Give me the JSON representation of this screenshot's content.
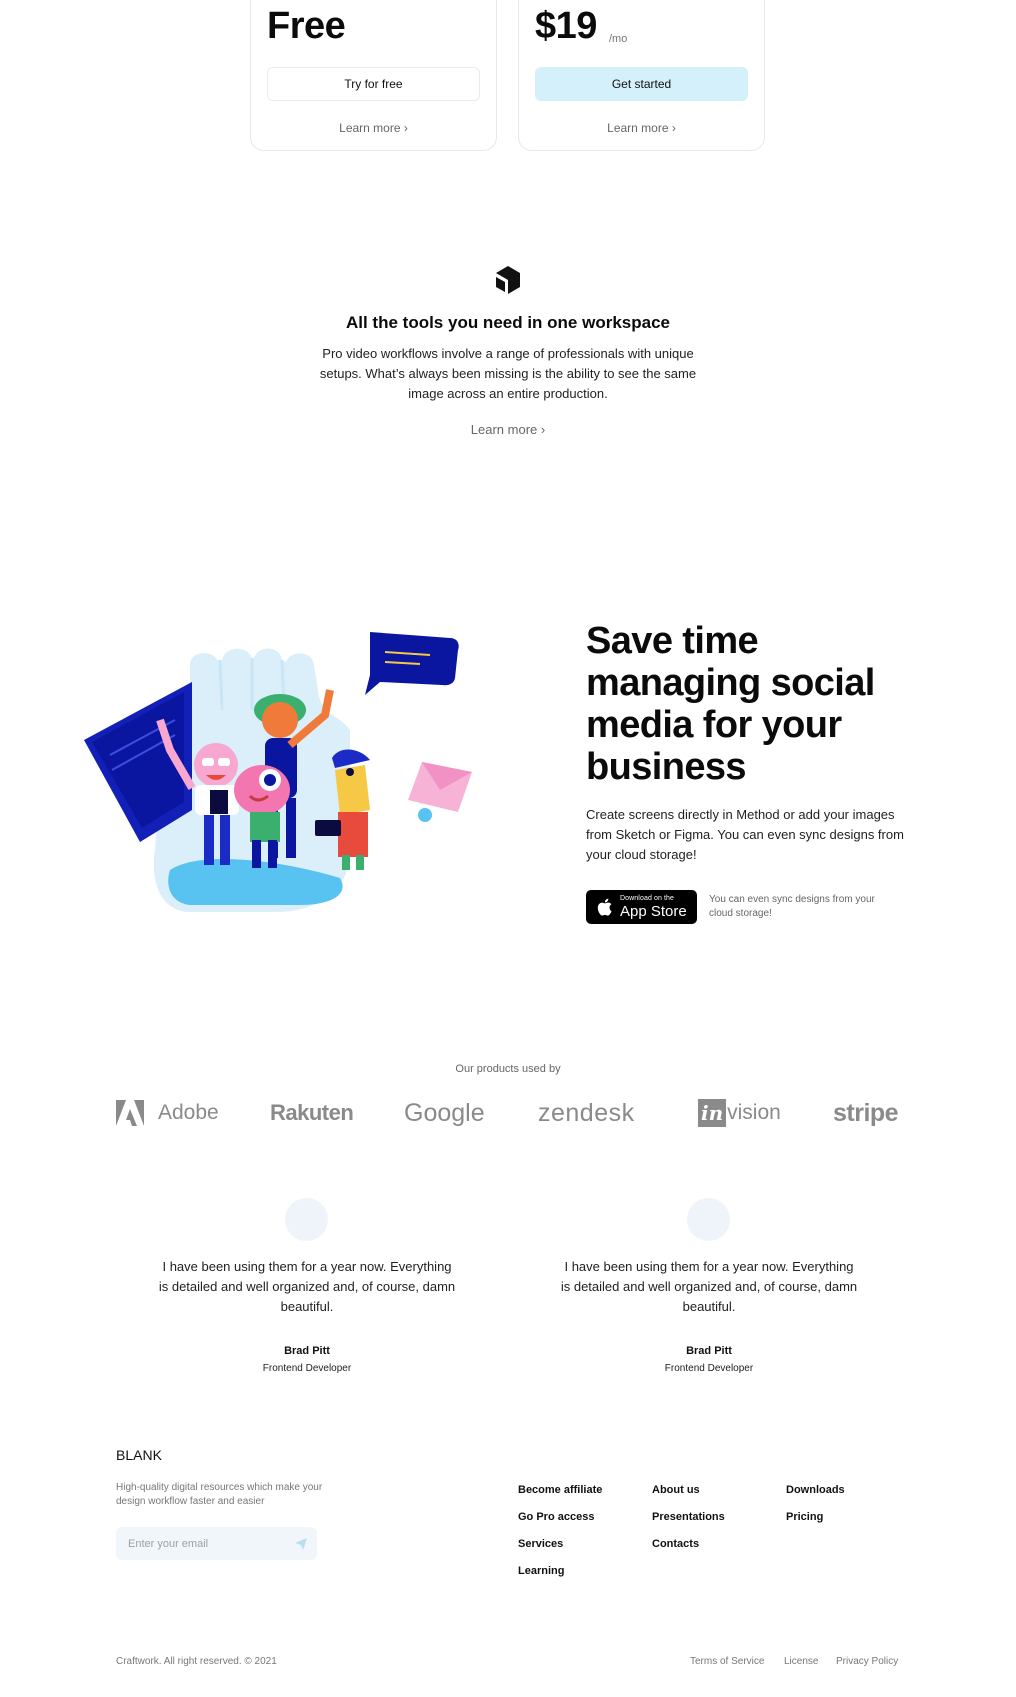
{
  "pricing": {
    "free": {
      "price": "Free",
      "button": "Try for free",
      "learn": "Learn more ›"
    },
    "pro": {
      "price": "$19",
      "period": "/mo",
      "button": "Get started",
      "learn": "Learn more ›"
    }
  },
  "tools": {
    "title": "All the tools you need in one workspace",
    "text": "Pro video workflows involve a range of professionals with unique setups. What’s always been missing is the ability to see the same image across an entire production.",
    "learn": "Learn more ›"
  },
  "feature": {
    "title_lines": [
      "Save time",
      "managing social",
      "media for your",
      "business"
    ],
    "text": "Create screens directly in Method or add your images from Sketch or Figma. You can even sync designs from your cloud storage!",
    "appstore_small": "Download on the",
    "appstore_big": "App Store",
    "note": "You can even sync designs from your cloud storage!"
  },
  "customers": {
    "heading": "Our products used by",
    "brands": [
      "Adobe",
      "Rakuten",
      "Google",
      "zendesk",
      "vision",
      "stripe"
    ],
    "invision_prefix": "in"
  },
  "testimonials": [
    {
      "quote": "I have been using them for a year now. Everything is detailed and well organized and, of course, damn beautiful.",
      "name": "Brad Pitt",
      "role": "Frontend Developer"
    },
    {
      "quote": "I have been using them for a year now. Everything is detailed and well organized and, of course, damn beautiful.",
      "name": "Brad Pitt",
      "role": "Frontend Developer"
    }
  ],
  "footer": {
    "brand": "BLANK",
    "description": "High-quality digital resources which make your design workflow faster and easier",
    "email_placeholder": "Enter your email",
    "col1": [
      "Become affiliate",
      "Go Pro access",
      "Services",
      "Learning"
    ],
    "col2": [
      "About us",
      "Presentations",
      "Contacts"
    ],
    "col3": [
      "Downloads",
      "Pricing"
    ],
    "copyright": "Craftwork. All right reserved. © 2021",
    "legal": [
      "Terms of Service",
      "License",
      "Privacy Policy"
    ]
  },
  "colors": {
    "accent_button": "#d4f0fa",
    "muted_text": "#777777"
  }
}
